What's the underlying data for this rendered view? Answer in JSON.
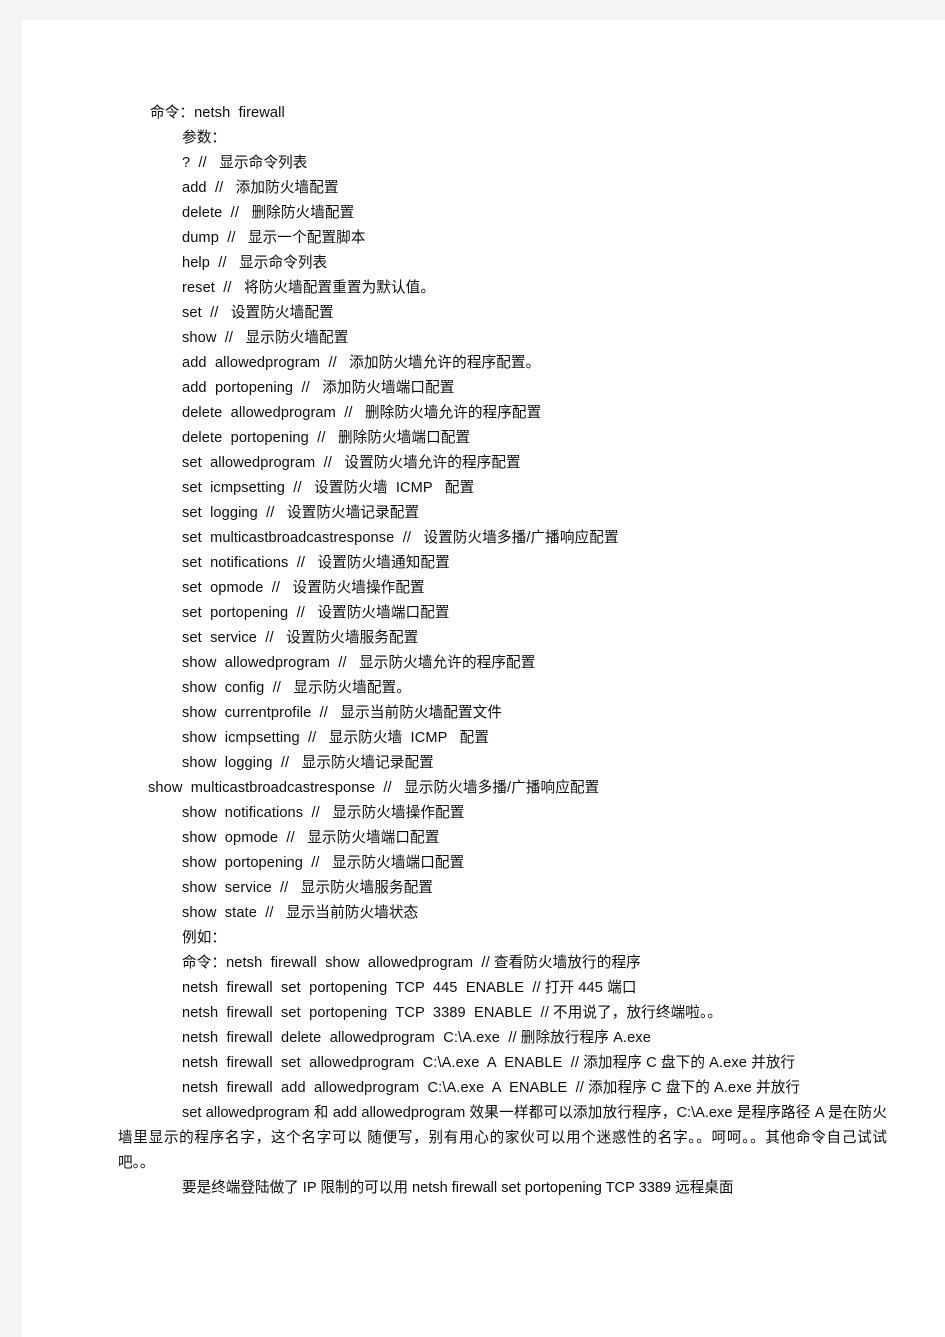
{
  "document": {
    "type": "scanned-text-page",
    "page_background": "#ffffff",
    "backdrop_color": "#f4f4f4",
    "text_color": "#0d0d0d",
    "header_line": "命令：netsh  firewall",
    "params_label": "参数：",
    "param_lines": [
      "?  //   显示命令列表",
      "add  //   添加防火墙配置",
      "delete  //   删除防火墙配置",
      "dump  //   显示一个配置脚本",
      "help  //   显示命令列表",
      "reset  //   将防火墙配置重置为默认值。",
      "set  //   设置防火墙配置",
      "show  //   显示防火墙配置",
      "add  allowedprogram  //   添加防火墙允许的程序配置。",
      "add  portopening  //   添加防火墙端口配置",
      "delete  allowedprogram  //   删除防火墙允许的程序配置",
      "delete  portopening  //   删除防火墙端口配置",
      "set  allowedprogram  //   设置防火墙允许的程序配置",
      "set  icmpsetting  //   设置防火墙  ICMP   配置",
      "set  logging  //   设置防火墙记录配置",
      "set  multicastbroadcastresponse  //   设置防火墙多播/广播响应配置",
      "set  notifications  //   设置防火墙通知配置",
      "set  opmode  //   设置防火墙操作配置",
      "set  portopening  //   设置防火墙端口配置",
      "set  service  //   设置防火墙服务配置",
      "show  allowedprogram  //   显示防火墙允许的程序配置",
      "show  config  //   显示防火墙配置。",
      "show  currentprofile  //   显示当前防火墙配置文件",
      "show  icmpsetting  //   显示防火墙  ICMP   配置",
      "show  logging  //   显示防火墙记录配置"
    ],
    "outdented_line": "show  multicastbroadcastresponse  //   显示防火墙多播/广播响应配置",
    "param_lines_tail": [
      "show  notifications  //   显示防火墙操作配置",
      "show  opmode  //   显示防火墙端口配置",
      "show  portopening  //   显示防火墙端口配置",
      "show  service  //   显示防火墙服务配置",
      "show  state  //   显示当前防火墙状态"
    ],
    "examples_label": "例如：",
    "example_lines": [
      "命令：netsh  firewall  show  allowedprogram  // 查看防火墙放行的程序",
      "netsh  firewall  set  portopening  TCP  445  ENABLE  // 打开 445 端口",
      "netsh  firewall  set  portopening  TCP  3389  ENABLE  // 不用说了，放行终端啦。。",
      "netsh  firewall  delete  allowedprogram  C:\\A.exe  // 删除放行程序 A.exe",
      "netsh  firewall  set  allowedprogram  C:\\A.exe  A  ENABLE  // 添加程序 C 盘下的 A.exe 并放行",
      "netsh  firewall  add  allowedprogram  C:\\A.exe  A  ENABLE  // 添加程序 C 盘下的 A.exe 并放行"
    ],
    "note_paragraph": "set  allowedprogram 和 add  allowedprogram 效果一样都可以添加放行程序，C:\\A.exe 是程序路径 A 是在防火墙里显示的程序名字，这个名字可以  随便写，别有用心的家伙可以用个迷惑性的名字。。呵呵。。其他命令自己试试吧。。",
    "closing_paragraph": "要是终端登陆做了 IP 限制的可以用 netsh  firewall  set  portopening  TCP  3389   远程桌面"
  }
}
